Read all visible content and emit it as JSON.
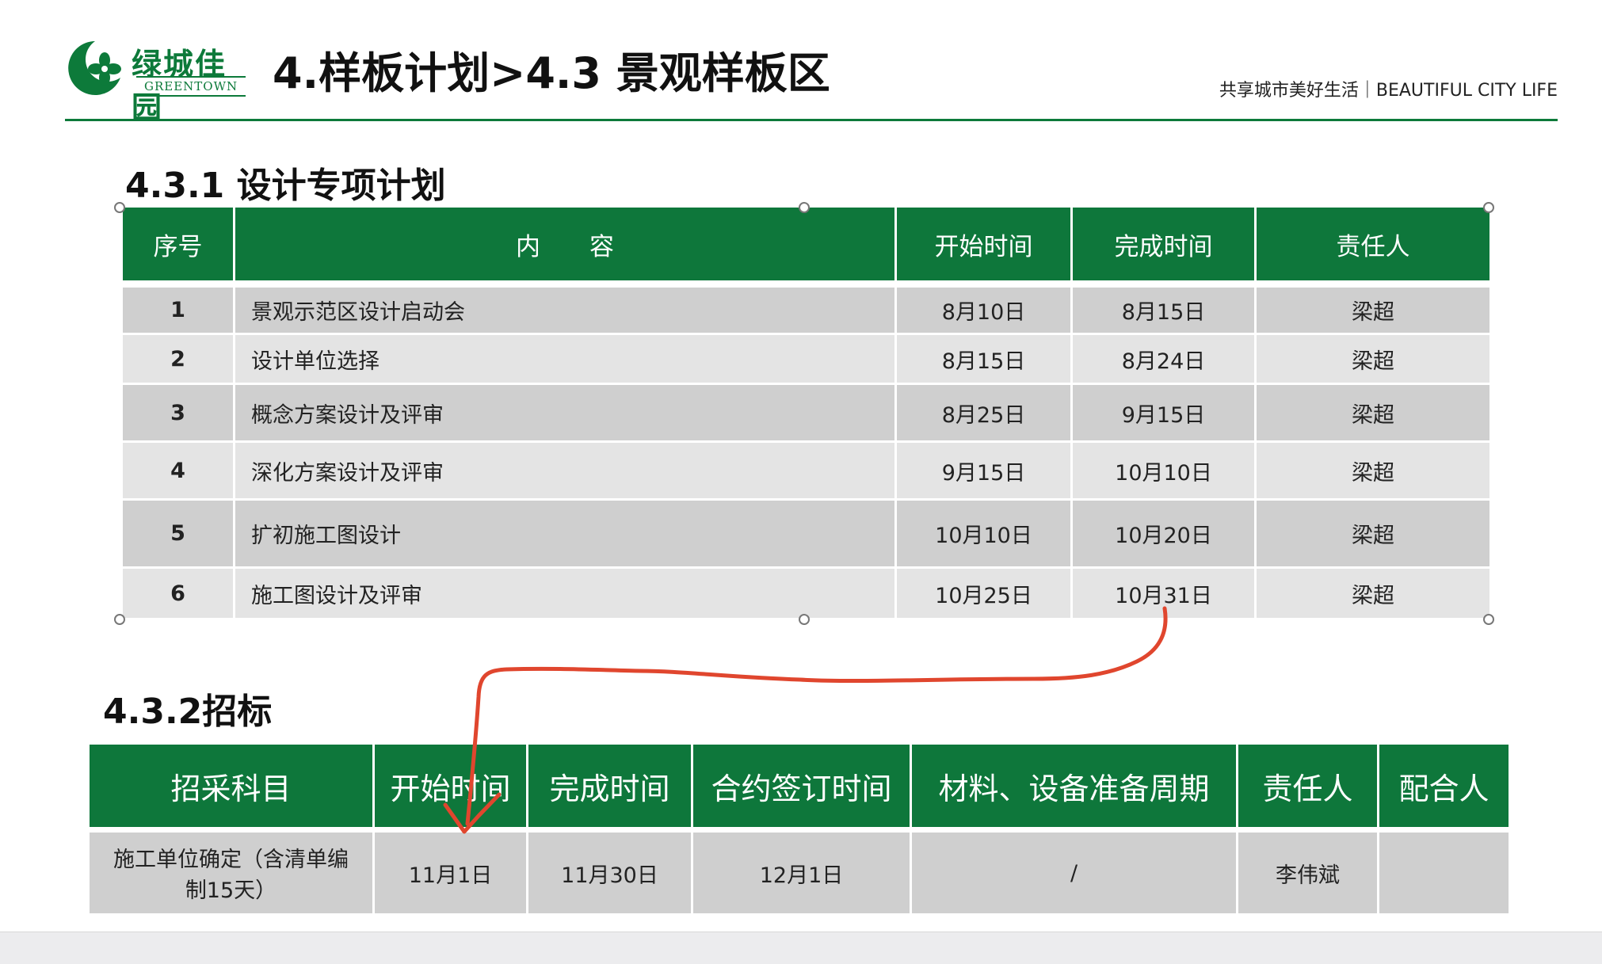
{
  "header": {
    "logo_cn": "绿城佳园",
    "logo_en": "GREENTOWN",
    "title": "4.样板计划>4.3 景观样板区",
    "slogan": "共享城市美好生活｜BEAUTIFUL CITY LIFE"
  },
  "section1": {
    "title": "4.3.1 设计专项计划",
    "headers": [
      "序号",
      "内　　容",
      "开始时间",
      "完成时间",
      "责任人"
    ],
    "rows": [
      {
        "no": "1",
        "content": "景观示范区设计启动会",
        "start": "8月10日",
        "end": "8月15日",
        "owner": "梁超"
      },
      {
        "no": "2",
        "content": "设计单位选择",
        "start": "8月15日",
        "end": "8月24日",
        "owner": "梁超"
      },
      {
        "no": "3",
        "content": "概念方案设计及评审",
        "start": "8月25日",
        "end": "9月15日",
        "owner": "梁超"
      },
      {
        "no": "4",
        "content": "深化方案设计及评审",
        "start": "9月15日",
        "end": "10月10日",
        "owner": "梁超"
      },
      {
        "no": "5",
        "content": "扩初施工图设计",
        "start": "10月10日",
        "end": "10月20日",
        "owner": "梁超"
      },
      {
        "no": "6",
        "content": "施工图设计及评审",
        "start": "10月25日",
        "end": "10月31日",
        "owner": "梁超"
      }
    ]
  },
  "section2": {
    "title": "4.3.2招标",
    "headers": [
      "招采科目",
      "开始时间",
      "完成时间",
      "合约签订时间",
      "材料、设备准备周期",
      "责任人",
      "配合人"
    ],
    "row": {
      "item": "施工单位确定（含清单编制15天）",
      "start": "11月1日",
      "end": "11月30日",
      "contract": "12月1日",
      "prep": "/",
      "owner": "李伟斌",
      "assist": ""
    }
  },
  "colors": {
    "brand_green": "#0e773b",
    "annotation_red": "#e0462e",
    "row_dark": "#cfcfcf",
    "row_light": "#e4e4e4"
  }
}
